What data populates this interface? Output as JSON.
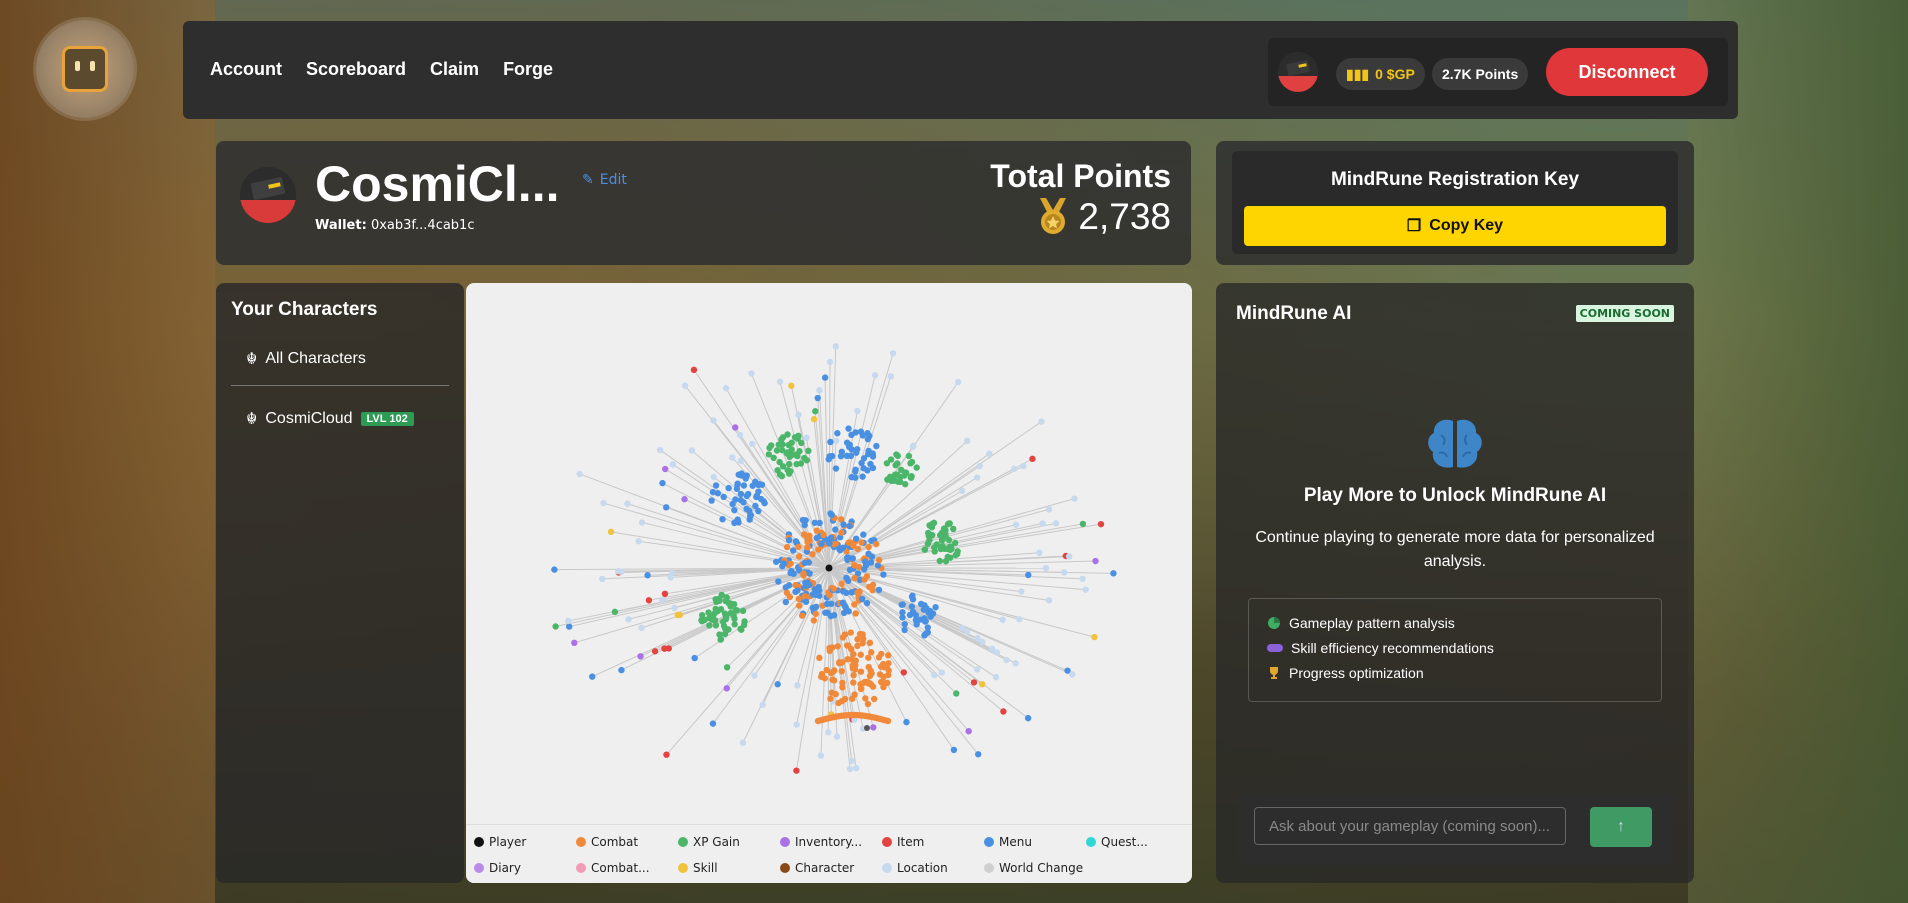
{
  "nav": {
    "account": "Account",
    "scoreboard": "Scoreboard",
    "claim": "Claim",
    "forge": "Forge"
  },
  "wallet": {
    "gp": "0 $GP",
    "points": "2.7K Points",
    "disconnect": "Disconnect"
  },
  "profile": {
    "name": "CosmiCl...",
    "edit": "Edit",
    "wallet_label": "Wallet:",
    "wallet_value": "0xab3f...4cab1c",
    "total_label": "Total Points",
    "total_value": "2,738"
  },
  "characters": {
    "title": "Your Characters",
    "all": "All Characters",
    "items": [
      {
        "name": "CosmiCloud",
        "level": "LVL 102"
      }
    ]
  },
  "legend": [
    "Player",
    "Combat",
    "XP Gain",
    "Inventory...",
    "Item",
    "Menu",
    "Quest...",
    "Diary",
    "Combat...",
    "Skill",
    "Character",
    "Location",
    "World Change"
  ],
  "legend_colors": [
    "#111111",
    "#f08a3a",
    "#4bb66a",
    "#a971e5",
    "#e4433f",
    "#4a90e2",
    "#2ed7d5",
    "#b98be8",
    "#f29ab6",
    "#f0c23d",
    "#8a4a18",
    "#c7d9ee",
    "#cfcfcf"
  ],
  "key": {
    "title": "MindRune Registration Key",
    "copy": "Copy Key"
  },
  "ai": {
    "title": "MindRune AI",
    "badge": "COMING SOON",
    "headline": "Play More to Unlock MindRune AI",
    "body": "Continue playing to generate more data for personalized analysis.",
    "features": [
      "Gameplay pattern analysis",
      "Skill efficiency recommendations",
      "Progress optimization"
    ],
    "placeholder": "Ask about your gameplay (coming soon)..."
  }
}
